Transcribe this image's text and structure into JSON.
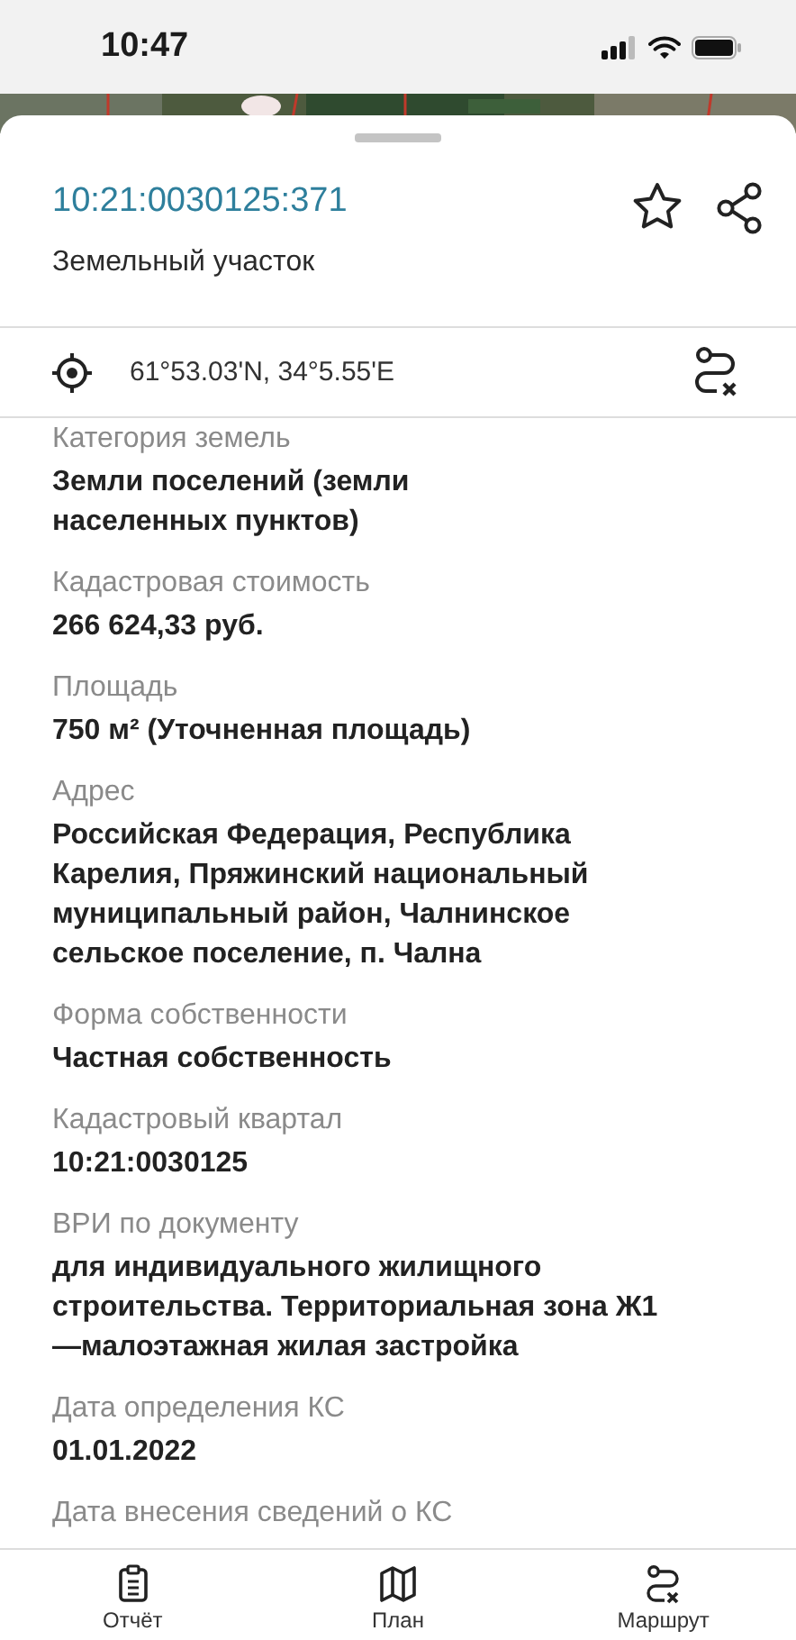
{
  "status_bar": {
    "time": "10:47"
  },
  "sheet": {
    "title": "10:21:0030125:371",
    "subtitle": "Земельный участок",
    "coordinates": "61°53.03'N, 34°5.55'E"
  },
  "fields": [
    {
      "label": "Категория земель",
      "value": "Земли поселений (земли\nнаселенных пунктов)"
    },
    {
      "label": "Кадастровая стоимость",
      "value": "266 624,33 руб."
    },
    {
      "label": "Площадь",
      "value": "750 м² (Уточненная площадь)"
    },
    {
      "label": "Адрес",
      "value": "Российская Федерация, Республика\nКарелия, Пряжинский национальный\nмуниципальный район, Чалнинское\nсельское поселение, п. Чална"
    },
    {
      "label": "Форма собственности",
      "value": "Частная собственность"
    },
    {
      "label": "Кадастровый квартал",
      "value": "10:21:0030125"
    },
    {
      "label": "ВРИ по документу",
      "value": "для индивидуального жилищного\nстроительства. Территориальная зона Ж1\n—малоэтажная жилая застройка"
    },
    {
      "label": "Дата определения КС",
      "value": "01.01.2022"
    },
    {
      "label": "Дата внесения сведений о КС"
    }
  ],
  "tab_bar": [
    {
      "kind": "report",
      "label": "Отчёт"
    },
    {
      "kind": "plan",
      "label": "План"
    },
    {
      "kind": "route",
      "label": "Маршрут"
    }
  ]
}
